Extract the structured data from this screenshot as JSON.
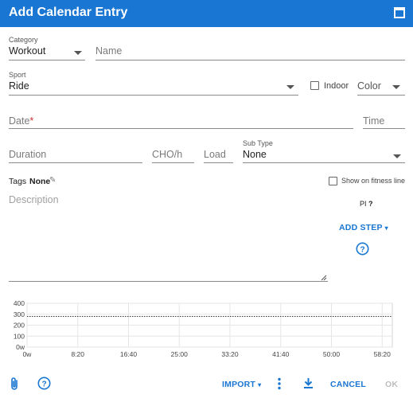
{
  "dialog": {
    "title": "Add Calendar Entry"
  },
  "form": {
    "category": {
      "label": "Category",
      "value": "Workout"
    },
    "name": {
      "placeholder": "Name"
    },
    "sport": {
      "label": "Sport",
      "value": "Ride"
    },
    "indoor": {
      "label": "Indoor",
      "checked": false
    },
    "color": {
      "placeholder": "Color"
    },
    "date": {
      "placeholder": "Date",
      "required_mark": "*"
    },
    "time": {
      "placeholder": "Time"
    },
    "duration": {
      "placeholder": "Duration"
    },
    "cho": {
      "placeholder": "CHO/h"
    },
    "load": {
      "placeholder": "Load"
    },
    "subtype": {
      "label": "Sub Type",
      "value": "None"
    },
    "tags": {
      "label": "Tags",
      "value": "None"
    },
    "fitness_line": {
      "label": "Show on fitness line",
      "checked": false
    },
    "description": {
      "placeholder": "Description"
    },
    "pi": {
      "label": "PI",
      "help": "?"
    },
    "add_step": {
      "label": "ADD STEP"
    }
  },
  "chart_data": {
    "type": "line",
    "y_ticks": [
      "400",
      "300",
      "200",
      "100",
      "0w"
    ],
    "x_ticks": [
      "0w",
      "8:20",
      "16:40",
      "25:00",
      "33:20",
      "41:40",
      "50:00",
      "58:20"
    ],
    "ylim": [
      0,
      400
    ],
    "xlim_seconds": [
      0,
      3600
    ],
    "reference_line": {
      "y": 280,
      "style": "dotted"
    },
    "grid": true,
    "series": []
  },
  "footer": {
    "import_label": "IMPORT",
    "cancel_label": "CANCEL",
    "ok_label": "OK"
  },
  "colors": {
    "primary": "#1976d2",
    "required": "#d32f2f",
    "disabled": "#bdbdbd"
  }
}
